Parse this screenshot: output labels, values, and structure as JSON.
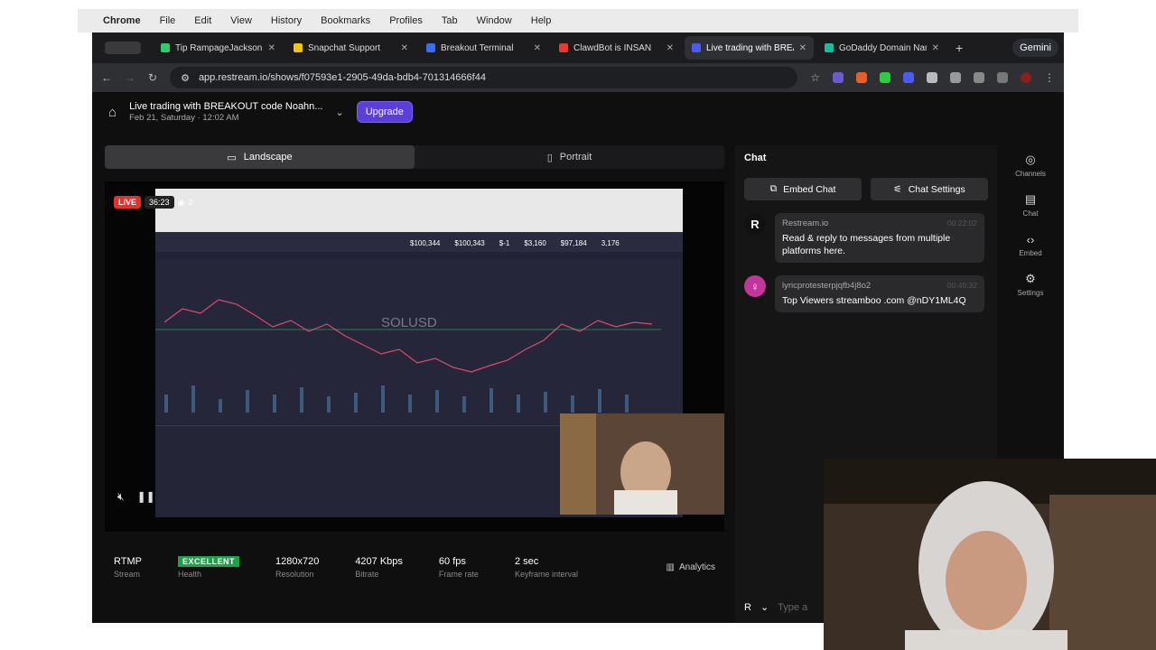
{
  "menubar": {
    "apple": "",
    "app": "Chrome",
    "items": [
      "File",
      "Edit",
      "View",
      "History",
      "Bookmarks",
      "Profiles",
      "Tab",
      "Window",
      "Help"
    ]
  },
  "tabs": [
    {
      "title": "Tip RampageJackson",
      "color": "#2ecc71"
    },
    {
      "title": "Snapchat Support",
      "color": "#f1c40f"
    },
    {
      "title": "Breakout Terminal",
      "color": "#3a6df0"
    },
    {
      "title": "ClawdBot is INSAN",
      "color": "#e53935"
    },
    {
      "title": "Live trading with BREA",
      "color": "#4a5cf0"
    },
    {
      "title": "GoDaddy Domain Nam",
      "color": "#1abc9c"
    }
  ],
  "gemini": "Gemini",
  "url": "app.restream.io/shows/f07593e1-2905-49da-bdb4-701314666f44",
  "header": {
    "title": "Live trading with BREAKOUT code Noahn...",
    "subtitle": "Feb 21, Saturday · 12:02 AM",
    "upgrade": "Upgrade"
  },
  "orientation": {
    "landscape": "Landscape",
    "portrait": "Portrait"
  },
  "preview": {
    "live": "LIVE",
    "timer": "36:23",
    "viewers": "2",
    "symbol": "SOLUSD",
    "nums": [
      "$100,344",
      "$100,343",
      "$-1",
      "$3,160",
      "$97,184",
      "3,176"
    ]
  },
  "stats": [
    {
      "value": "RTMP",
      "label": "Stream"
    },
    {
      "value": "EXCELLENT",
      "label": "Health"
    },
    {
      "value": "1280x720",
      "label": "Resolution"
    },
    {
      "value": "4207 Kbps",
      "label": "Bitrate"
    },
    {
      "value": "60 fps",
      "label": "Frame rate"
    },
    {
      "value": "2 sec",
      "label": "Keyframe interval"
    }
  ],
  "analytics": "Analytics",
  "chat": {
    "title": "Chat",
    "embed": "Embed Chat",
    "settings": "Chat Settings",
    "messages": [
      {
        "user": "Restream.io",
        "time": "00:22:02",
        "text": "Read & reply to messages from multiple platforms here.",
        "avatar": "R",
        "color": "#111"
      },
      {
        "user": "lyricprotesterpjqfb4j8o2",
        "time": "00:49:32",
        "text": "Top Viewers streamboo .com @nDY1ML4Q",
        "avatar": "",
        "color": "#c2359a"
      }
    ],
    "input_placeholder": "Type a"
  },
  "rail": [
    {
      "label": "Channels",
      "icon": "channels-icon"
    },
    {
      "label": "Chat",
      "icon": "chat-icon"
    },
    {
      "label": "Embed",
      "icon": "embed-icon"
    },
    {
      "label": "Settings",
      "icon": "settings-icon"
    }
  ]
}
